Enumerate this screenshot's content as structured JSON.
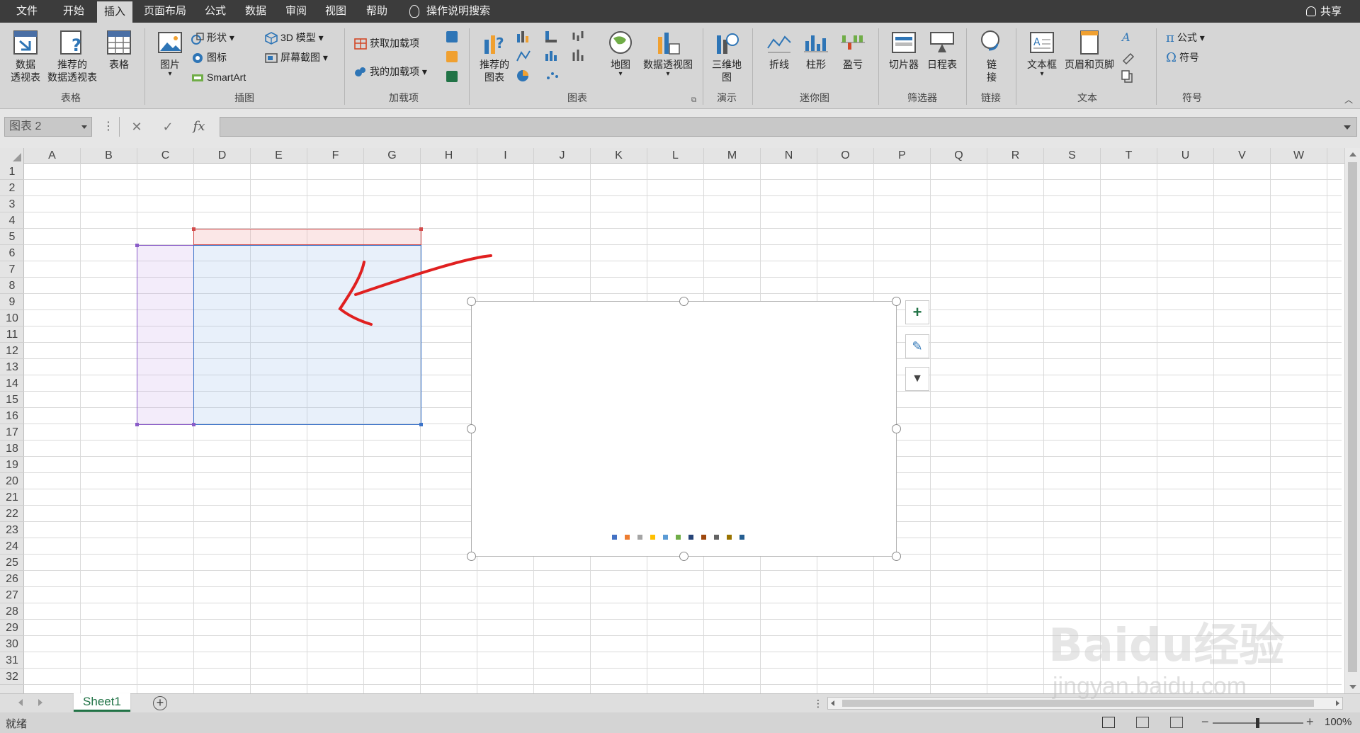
{
  "tabs": [
    "文件",
    "开始",
    "插入",
    "页面布局",
    "公式",
    "数据",
    "审阅",
    "视图",
    "帮助"
  ],
  "active_tab": "插入",
  "tell_me": "操作说明搜索",
  "share": "共享",
  "ribbon": {
    "tables": {
      "pivot": "数据\n透视表",
      "rec_pivot": "推荐的\n数据透视表",
      "table": "表格",
      "group": "表格"
    },
    "illustrations": {
      "pictures": "图片",
      "shapes": "形状",
      "icons": "图标",
      "smartart": "SmartArt",
      "model3d": "3D 模型",
      "screenshot": "屏幕截图",
      "group": "插图"
    },
    "addins": {
      "get": "获取加载项",
      "mine": "我的加载项",
      "group": "加载项"
    },
    "charts": {
      "recommended": "推荐的\n图表",
      "map": "地图",
      "pivot_chart": "数据透视图",
      "group": "图表"
    },
    "tours": {
      "map3d": "三维地\n图",
      "group": "演示"
    },
    "sparklines": {
      "line": "折线",
      "column": "柱形",
      "winloss": "盈亏",
      "group": "迷你图"
    },
    "filters": {
      "slicer": "切片器",
      "timeline": "日程表",
      "group": "筛选器"
    },
    "links": {
      "link": "链\n接",
      "group": "链接"
    },
    "text": {
      "textbox": "文本框",
      "header_footer": "页眉和页脚",
      "group": "文本"
    },
    "symbols": {
      "equation": "公式",
      "symbol": "符号",
      "group": "符号"
    }
  },
  "formula_bar": {
    "name_box": "图表 2",
    "cancel": "✕",
    "enter": "✓",
    "fx": "fx",
    "value": ""
  },
  "columns": [
    "A",
    "B",
    "C",
    "D",
    "E",
    "F",
    "G",
    "H",
    "I",
    "J",
    "K",
    "L",
    "M",
    "N",
    "O",
    "P",
    "Q",
    "R",
    "S",
    "T",
    "U",
    "V",
    "W"
  ],
  "rows": [
    "1",
    "2",
    "3",
    "4",
    "5",
    "6",
    "7",
    "8",
    "9",
    "10",
    "11",
    "12",
    "13",
    "14",
    "15",
    "16",
    "17",
    "18",
    "19",
    "20",
    "21",
    "22",
    "23",
    "24",
    "25",
    "26",
    "27",
    "28",
    "29",
    "30",
    "31",
    "32"
  ],
  "chart": {
    "side_buttons": [
      "+",
      "✎",
      "▼"
    ],
    "legend_colors": [
      "#4472c4",
      "#ed7d31",
      "#a5a5a5",
      "#ffc000",
      "#5b9bd5",
      "#70ad47",
      "#264478",
      "#9e480e",
      "#636363",
      "#997300",
      "#255e91"
    ]
  },
  "sheet_tab": "Sheet1",
  "add_sheet": "+",
  "status": "就绪",
  "zoom": "100%",
  "zoom_minus": "−",
  "zoom_plus": "+",
  "colors": {
    "accent": "#217346",
    "tabbar": "#3c3c3c",
    "ribbon": "#d6d6d6",
    "annotation": "#e02020"
  },
  "watermark": {
    "brand": "Baidu经验",
    "url": "jingyan.baidu.com"
  }
}
